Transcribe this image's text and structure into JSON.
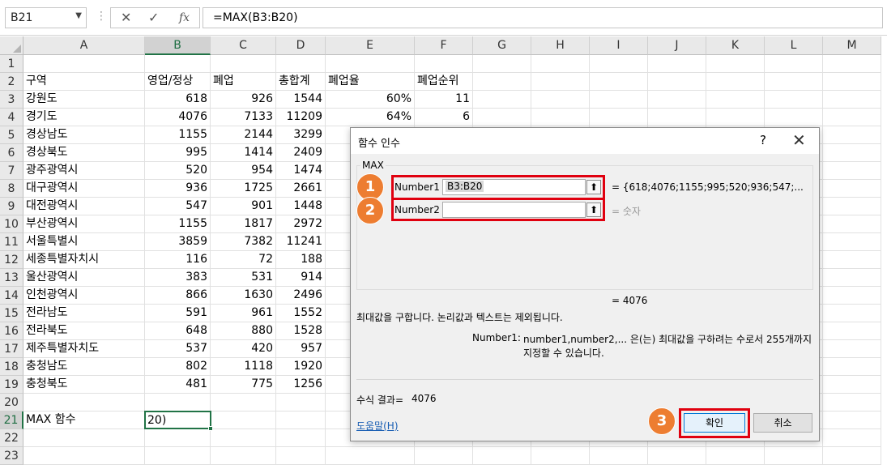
{
  "namebox": {
    "value": "B21"
  },
  "formula_bar": {
    "formula": "=MAX(B3:B20)"
  },
  "columns": [
    "A",
    "B",
    "C",
    "D",
    "E",
    "F",
    "G",
    "H",
    "I",
    "J",
    "K",
    "L",
    "M"
  ],
  "rows": [
    "1",
    "2",
    "3",
    "4",
    "5",
    "6",
    "7",
    "8",
    "9",
    "10",
    "11",
    "12",
    "13",
    "14",
    "15",
    "16",
    "17",
    "18",
    "19",
    "20",
    "21",
    "22",
    "23"
  ],
  "sheet": {
    "headers": {
      "A": "구역",
      "B": "영업/정상",
      "C": "폐업",
      "D": "총합계",
      "E": "폐업율",
      "F": "폐업순위"
    },
    "data": [
      {
        "A": "강원도",
        "B": "618",
        "C": "926",
        "D": "1544",
        "E": "60%",
        "F": "11"
      },
      {
        "A": "경기도",
        "B": "4076",
        "C": "7133",
        "D": "11209",
        "E": "64%",
        "F": "6"
      },
      {
        "A": "경상남도",
        "B": "1155",
        "C": "2144",
        "D": "3299"
      },
      {
        "A": "경상북도",
        "B": "995",
        "C": "1414",
        "D": "2409"
      },
      {
        "A": "광주광역시",
        "B": "520",
        "C": "954",
        "D": "1474"
      },
      {
        "A": "대구광역시",
        "B": "936",
        "C": "1725",
        "D": "2661"
      },
      {
        "A": "대전광역시",
        "B": "547",
        "C": "901",
        "D": "1448"
      },
      {
        "A": "부산광역시",
        "B": "1155",
        "C": "1817",
        "D": "2972"
      },
      {
        "A": "서울특별시",
        "B": "3859",
        "C": "7382",
        "D": "11241"
      },
      {
        "A": "세종특별자치시",
        "B": "116",
        "C": "72",
        "D": "188"
      },
      {
        "A": "울산광역시",
        "B": "383",
        "C": "531",
        "D": "914"
      },
      {
        "A": "인천광역시",
        "B": "866",
        "C": "1630",
        "D": "2496"
      },
      {
        "A": "전라남도",
        "B": "591",
        "C": "961",
        "D": "1552"
      },
      {
        "A": "전라북도",
        "B": "648",
        "C": "880",
        "D": "1528"
      },
      {
        "A": "제주특별자치도",
        "B": "537",
        "C": "420",
        "D": "957"
      },
      {
        "A": "충청남도",
        "B": "802",
        "C": "1118",
        "D": "1920"
      },
      {
        "A": "충청북도",
        "B": "481",
        "C": "775",
        "D": "1256"
      }
    ],
    "row21": {
      "A": "MAX 함수",
      "B": "20)"
    }
  },
  "dialog": {
    "title": "함수 인수",
    "help_symbol": "?",
    "close_symbol": "✕",
    "function_name": "MAX",
    "arg1_label": "Number1",
    "arg1_value": "B3:B20",
    "arg1_result": "=  {618;4076;1155;995;520;936;547;...",
    "arg2_label": "Number2",
    "arg2_value": "",
    "arg2_result": "=  숫자",
    "result_line": "=   4076",
    "description": "최대값을 구합니다. 논리값과 텍스트는 제외됩니다.",
    "arg_help_label": "Number1:",
    "arg_help_line1": "number1,number2,... 은(는) 최대값을 구하려는 수로서 255개까지",
    "arg_help_line2": "지정할 수 있습니다.",
    "formula_result_label": "수식 결과=",
    "formula_result_value": "4076",
    "help_link": "도움말(H)",
    "ok_label": "확인",
    "cancel_label": "취소"
  },
  "badges": [
    "1",
    "2",
    "3"
  ],
  "colors": {
    "accent_green": "#217346",
    "highlight_red": "#e0000f",
    "badge_orange": "#ed7d31"
  }
}
